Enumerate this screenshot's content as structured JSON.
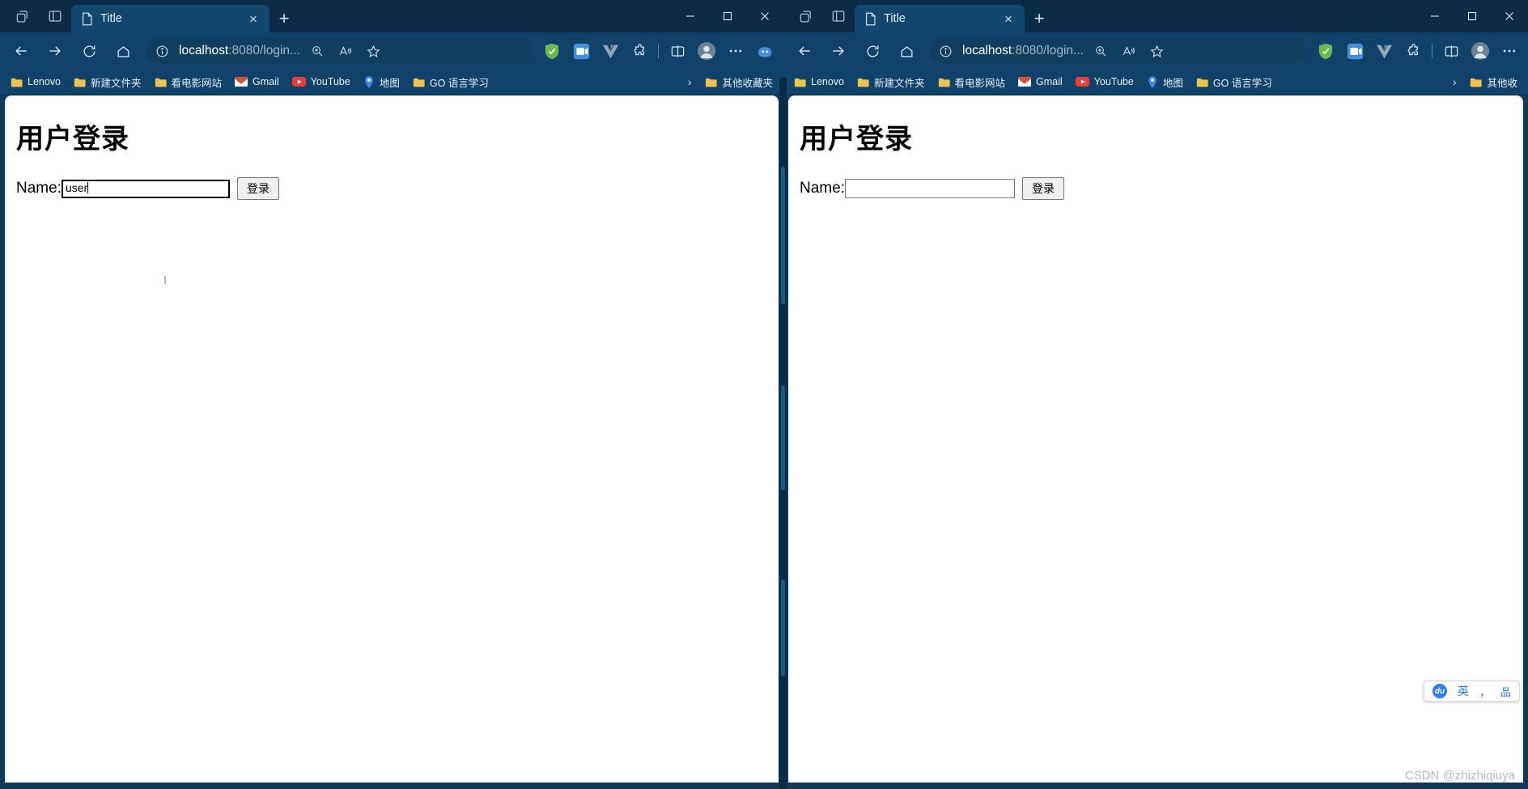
{
  "windows": [
    {
      "id": "left",
      "tab": {
        "title": "Title",
        "close_label": "×"
      },
      "newtab_label": "+",
      "window_controls": {
        "minimize": "─",
        "maximize": "□",
        "close": "✕"
      },
      "nav": {
        "back_icon": "back-arrow-icon",
        "forward_icon": "forward-arrow-icon",
        "reload_icon": "reload-icon",
        "home_icon": "home-icon"
      },
      "omnibox": {
        "info_icon": "site-info-icon",
        "url_host": "localhost",
        "url_path": ":8080/login...",
        "zoom_icon": "zoom-in-icon",
        "read_aloud_icon": "read-aloud-icon",
        "favorite_icon": "star-icon"
      },
      "extensions": [
        {
          "name": "adguard-shield-icon",
          "color": "#66bb4a"
        },
        {
          "name": "video-downloader-icon",
          "color": "#2f7dd1"
        },
        {
          "name": "vue-devtools-icon",
          "color": "#9aa7b0"
        },
        {
          "name": "extensions-puzzle-icon",
          "color": "#d8e4ec"
        },
        {
          "name": "split-screen-icon",
          "color": "#d8e4ec"
        },
        {
          "name": "profile-avatar-icon",
          "color": "#7d8f9c"
        },
        {
          "name": "settings-more-icon",
          "color": "#d8e4ec"
        },
        {
          "name": "copilot-icon",
          "color": "#2f7dd1"
        }
      ],
      "bookmarks": [
        {
          "label": "Lenovo",
          "icon": "folder-icon"
        },
        {
          "label": "新建文件夹",
          "icon": "folder-icon"
        },
        {
          "label": "看电影网站",
          "icon": "folder-icon"
        },
        {
          "label": "Gmail",
          "icon": "gmail-icon"
        },
        {
          "label": "YouTube",
          "icon": "youtube-icon"
        },
        {
          "label": "地图",
          "icon": "maps-icon"
        },
        {
          "label": "GO 语言学习",
          "icon": "folder-icon"
        }
      ],
      "bookmarks_overflow": "›",
      "other_bookmarks": {
        "label": "其他收藏夹",
        "icon": "folder-icon"
      },
      "page": {
        "heading": "用户登录",
        "name_label": "Name:",
        "name_value": "user",
        "name_placeholder": "",
        "submit_label": "登录",
        "input_focused": true
      }
    },
    {
      "id": "right",
      "tab": {
        "title": "Title",
        "close_label": "×"
      },
      "newtab_label": "+",
      "window_controls": {
        "minimize": "─",
        "maximize": "□",
        "close": "✕"
      },
      "omnibox": {
        "info_icon": "site-info-icon",
        "url_host": "localhost",
        "url_path": ":8080/login...",
        "zoom_icon": "zoom-in-icon",
        "read_aloud_icon": "read-aloud-icon",
        "favorite_icon": "star-icon"
      },
      "bookmarks": [
        {
          "label": "Lenovo",
          "icon": "folder-icon"
        },
        {
          "label": "新建文件夹",
          "icon": "folder-icon"
        },
        {
          "label": "看电影网站",
          "icon": "folder-icon"
        },
        {
          "label": "Gmail",
          "icon": "gmail-icon"
        },
        {
          "label": "YouTube",
          "icon": "youtube-icon"
        },
        {
          "label": "地图",
          "icon": "maps-icon"
        },
        {
          "label": "GO 语言学习",
          "icon": "folder-icon"
        }
      ],
      "bookmarks_overflow": "›",
      "other_bookmarks": {
        "label": "其他收",
        "icon": "folder-icon"
      },
      "page": {
        "heading": "用户登录",
        "name_label": "Name:",
        "name_value": "",
        "name_placeholder": "",
        "submit_label": "登录",
        "input_focused": false
      }
    }
  ],
  "ime": {
    "logo_text": "du",
    "mode_label": "英",
    "punctuation_label": "，",
    "keyboard_label": "品"
  },
  "watermark": "CSDN @zhizhiqiuya",
  "colors": {
    "browser_chrome": "#0f4369",
    "tabstrip": "#0b2b45",
    "active_tab": "#10496d",
    "page_bg": "#ffffff",
    "accent_blue": "#2b7cff"
  }
}
